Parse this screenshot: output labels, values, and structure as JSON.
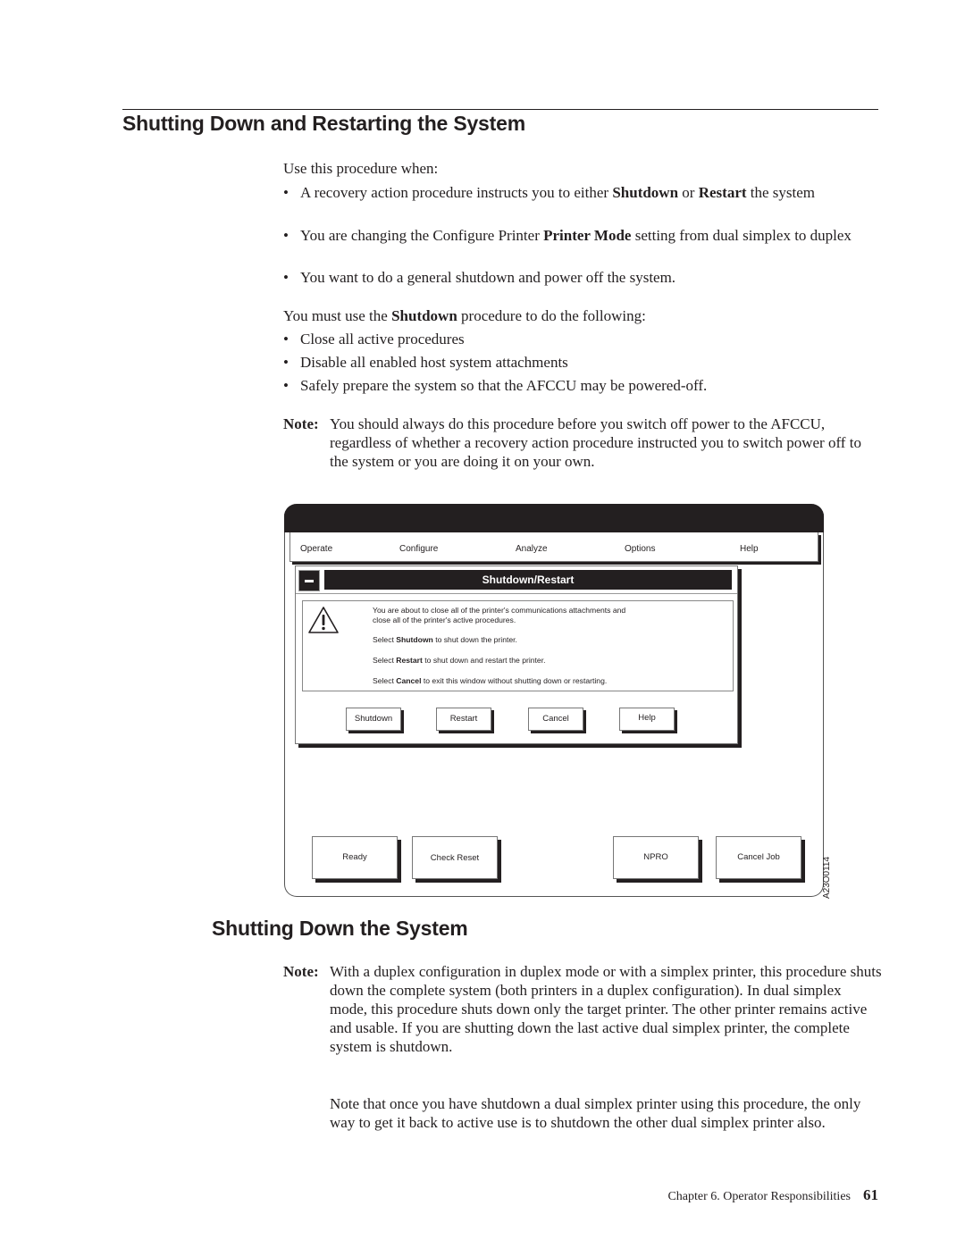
{
  "section1": {
    "title": "Shutting Down and Restarting the System",
    "intro": "Use this procedure when:",
    "when_bullets": [
      {
        "pre": "A recovery action procedure instructs you to either ",
        "b1": "Shutdown",
        "mid": " or ",
        "b2": "Restart",
        "post": " the system"
      },
      {
        "pre": "You are changing the Configure Printer ",
        "b1": "Printer Mode",
        "post": " setting from dual simplex to duplex"
      },
      {
        "text": "You want to do a general shutdown and power off the system."
      }
    ],
    "must_intro": {
      "pre": "You must use the ",
      "b1": "Shutdown",
      "post": " procedure to do the following:"
    },
    "must_bullets": [
      "Close all active procedures",
      "Disable all enabled host system attachments",
      "Safely prepare the system so that the AFCCU may be powered-off."
    ],
    "note_label": "Note:",
    "note_text": "You should always do this procedure before you switch off power to the AFCCU, regardless of whether a recovery action procedure instructed you to switch power off to the system or you are doing it on your own."
  },
  "figure": {
    "menu": [
      "Operate",
      "Configure",
      "Analyze",
      "Options",
      "Help"
    ],
    "dialog": {
      "title": "Shutdown/Restart",
      "icon": "warning-icon",
      "message": [
        {
          "text": "You are about to close all of the printer's communications attachments and"
        },
        {
          "text": "close all of the printer's active procedures."
        },
        {
          "pre": "Select ",
          "b": "Shutdown",
          "post": " to shut down the printer."
        },
        {
          "pre": "Select ",
          "b": "Restart",
          "post": " to shut down and restart the printer."
        },
        {
          "pre": "Select ",
          "b": "Cancel",
          "post": " to exit this window without shutting down or restarting."
        }
      ],
      "buttons": [
        "Shutdown",
        "Restart",
        "Cancel",
        "Help"
      ]
    },
    "panel_buttons": [
      "Ready",
      "Check Reset",
      "NPRO",
      "Cancel Job"
    ],
    "figure_id": "A23O0114"
  },
  "section2": {
    "title": "Shutting Down the System",
    "note_label": "Note:",
    "note_text": "With a duplex configuration in duplex mode or with a simplex printer, this procedure shuts down the complete system (both printers in a duplex configuration). In dual simplex mode, this procedure shuts down only the target printer. The other printer remains active and usable. If you are shutting down the last active dual simplex printer, the complete system is shutdown.",
    "paragraph": "Note that once you have shutdown a dual simplex printer using this procedure, the only way to get it back to active use is to shutdown the other dual simplex printer also."
  },
  "footer": {
    "chapter": "Chapter 6. Operator Responsibilities",
    "page": "61"
  }
}
